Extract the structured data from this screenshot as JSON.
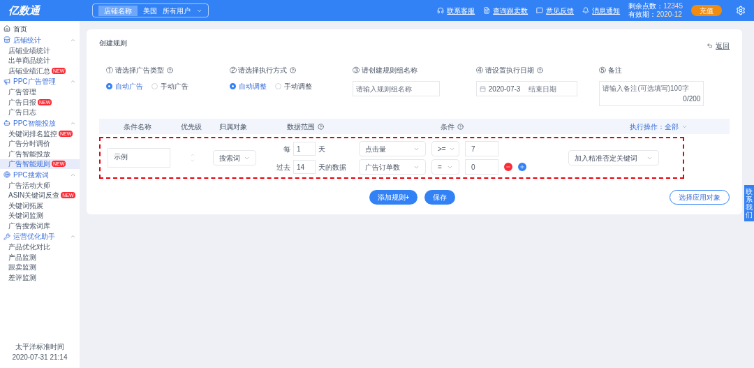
{
  "header": {
    "logo": "亿数通",
    "store": "店铺名称",
    "country": "美国",
    "user_filter": "所有用户",
    "links": [
      {
        "kind": "headset",
        "label": "联系客服"
      },
      {
        "kind": "doc",
        "label": "查询跟卖数"
      },
      {
        "kind": "chat",
        "label": "意见反馈"
      },
      {
        "kind": "bell",
        "label": "消息通知"
      }
    ],
    "points_label": "剩余点数：",
    "points_value": "12345",
    "expiry_label": "有效期：",
    "expiry_value": "2020-12",
    "recharge": "充值"
  },
  "sidebar": {
    "items": [
      {
        "kind": "home",
        "label": "首页"
      },
      {
        "kind": "shop",
        "label": "店铺统计",
        "expanded": true,
        "children": [
          {
            "label": "店铺业绩统计",
            "selected": false
          },
          {
            "label": "出单商品统计",
            "selected": false
          },
          {
            "label": "店铺业绩汇总",
            "badge": "NEW",
            "selected": false
          }
        ]
      },
      {
        "kind": "ppc",
        "label": "PPC广告管理",
        "expanded": true,
        "children": [
          {
            "label": "广告管理",
            "selected": false
          },
          {
            "label": "广告日报",
            "badge": "NEW",
            "selected": false
          },
          {
            "label": "广告日志",
            "selected": false
          }
        ]
      },
      {
        "kind": "ai",
        "label": "PPC智能投放",
        "expanded": true,
        "children": [
          {
            "label": "关键词排名监控",
            "badge": "NEW",
            "selected": false
          },
          {
            "label": "广告分时调价",
            "selected": false
          },
          {
            "label": "广告智能投放",
            "selected": false
          },
          {
            "label": "广告智能规则",
            "badge": "NEW",
            "selected": true
          }
        ]
      },
      {
        "kind": "target",
        "label": "PPC搜索词",
        "expanded": true,
        "children": [
          {
            "label": "广告活动大师",
            "selected": false
          },
          {
            "label": "ASIN关键词反查",
            "badge": "NEW",
            "selected": false
          },
          {
            "label": "关键词拓展",
            "selected": false
          },
          {
            "label": "关键词监测",
            "selected": false
          },
          {
            "label": "广告搜索词库",
            "selected": false
          }
        ]
      },
      {
        "kind": "tool",
        "label": "运营优化助手",
        "expanded": true,
        "children": [
          {
            "label": "产品优化对比",
            "selected": false
          },
          {
            "label": "产品监测",
            "selected": false
          },
          {
            "label": "跟卖监测",
            "selected": false
          },
          {
            "label": "差评监测",
            "selected": false
          }
        ]
      }
    ],
    "timezone": "太平洋标准时间",
    "time": "2020-07-31 21:14"
  },
  "page": {
    "title": "创建规则",
    "back": "返回",
    "steps": [
      {
        "kind": "radio",
        "label": "① 请选择广告类型",
        "help": true,
        "options": [
          {
            "label": "自动广告",
            "selected": true
          },
          {
            "label": "手动广告",
            "selected": false
          }
        ]
      },
      {
        "kind": "radio",
        "label": "② 请选择执行方式",
        "help": true,
        "options": [
          {
            "label": "自动调整",
            "selected": true
          },
          {
            "label": "手动调整",
            "selected": false
          }
        ]
      },
      {
        "kind": "input",
        "label": "③ 请创建规则组名称",
        "help": false,
        "placeholder": "请输入规则组名称"
      },
      {
        "kind": "dates",
        "label": "④ 请设置执行日期",
        "help": true,
        "value": "2020-07-3",
        "placeholder": "结束日期"
      },
      {
        "kind": "textarea",
        "label": "⑤ 备注",
        "help": false,
        "placeholder": "请输入备注(可选填写)100字",
        "count": "0/200"
      }
    ],
    "table": {
      "columns": [
        "条件名称",
        "优先级",
        "归属对象",
        "数据范围",
        "条件",
        "执行操作：全部"
      ],
      "row": {
        "name": "示例",
        "target": "搜索词",
        "every_label": "每",
        "every_value": "1",
        "every_unit": "天",
        "past_label": "过去",
        "past_value": "14",
        "past_unit": "天的数据",
        "conditions": [
          {
            "metric": "点击量",
            "operator": ">=",
            "value": "7"
          },
          {
            "metric": "广告订单数",
            "operator": "=",
            "value": "0"
          }
        ],
        "action": "加入精准否定关键词"
      }
    },
    "add_rule": "添加规则+",
    "save": "保存",
    "apply": "选择应用对象"
  },
  "float_tab": "联系我们"
}
